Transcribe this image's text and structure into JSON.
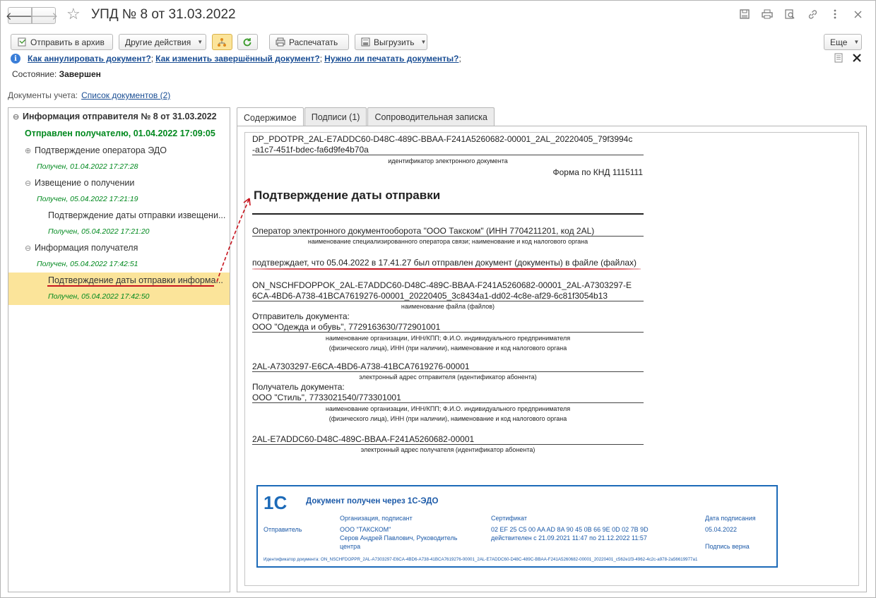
{
  "window": {
    "title": "УПД № 8 от 31.03.2022",
    "nav_back": "🡐",
    "nav_forward": "🡒",
    "star_icon": "☆",
    "icons": [
      "save-icon",
      "print-icon",
      "preview-icon",
      "link-icon",
      "more-icon",
      "close-icon"
    ]
  },
  "toolbar": {
    "archive_label": "Отправить в архив",
    "other_actions_label": "Другие действия",
    "print_label": "Распечатать",
    "export_label": "Выгрузить",
    "more_label": "Еще"
  },
  "help": {
    "link1": "Как аннулировать документ?",
    "link2": "Как изменить завершённый документ?",
    "link3": "Нужно ли печатать документы?",
    "sep": ";"
  },
  "state": {
    "label": "Состояние:",
    "value": "Завершен"
  },
  "docs": {
    "label": "Документы учета:",
    "link": "Список документов (2)"
  },
  "tree": {
    "root": "Информация отправителя № 8 от 31.03.2022",
    "root_status": "Отправлен получателю, 01.04.2022 17:09:05",
    "items": [
      {
        "label": "Подтверждение оператора ЭДО",
        "status": "Получен, 01.04.2022 17:27:28"
      },
      {
        "label": "Извещение о получении",
        "status": "Получен, 05.04.2022 17:21:19"
      },
      {
        "label": "Подтверждение даты отправки извещени...",
        "status": "Получен, 05.04.2022 17:21:20"
      },
      {
        "label": "Информация получателя",
        "status": "Получен, 05.04.2022 17:42:51"
      },
      {
        "label": "Подтверждение даты отправки информа...",
        "status": "Получен, 05.04.2022 17:42:50"
      }
    ]
  },
  "tabs": [
    {
      "label": "Содержимое"
    },
    {
      "label": "Подписи (1)"
    },
    {
      "label": "Сопроводительная записка"
    }
  ],
  "document": {
    "id_line1": "DP_PDOTPR_2AL-E7ADDC60-D48C-489C-BBAA-F241A5260682-00001_2AL_20220405_79f3994c",
    "id_line2": "-a1c7-451f-bdec-fa6d9fe4b70a",
    "id_caption": "идентификатор электронного документа",
    "form": "Форма по КНД 1115111",
    "title": "Подтверждение даты отправки",
    "operator": "Оператор электронного документооборота \"ООО Такском\" (ИНН 7704211201, код 2AL)",
    "operator_caption": "наименование специализированного оператора связи; наименование и код налогового органа",
    "confirms": "подтверждает, что 05.04.2022 в 17.41.27 был отправлен документ (документы) в файле (файлах)",
    "file_line1": "ON_NSCHFDOPPOK_2AL-E7ADDC60-D48C-489C-BBAA-F241A5260682-00001_2AL-A7303297-E",
    "file_line2": "6CA-4BD6-A738-41BCA7619276-00001_20220405_3c8434a1-dd02-4c8e-af29-6c81f3054b13",
    "file_caption": "наименование файла (файлов)",
    "sender_label": "Отправитель документа:",
    "sender": "ООО \"Одежда и обувь\", 7729163630/772901001",
    "org_caption1": "наименование организации, ИНН/КПП; Ф.И.О. индивидуального предпринимателя",
    "org_caption2": "(физического лица), ИНН (при наличии), наименование и код налогового органа",
    "sender_addr": "2AL-A7303297-E6CA-4BD6-A738-41BCA7619276-00001",
    "sender_addr_caption": "электронный адрес отправителя (идентификатор абонента)",
    "recipient_label": "Получатель документа:",
    "recipient": "ООО \"Стиль\", 7733021540/773301001",
    "recipient_addr": "2AL-E7ADDC60-D48C-489C-BBAA-F241A5260682-00001",
    "recipient_addr_caption": "электронный адрес получателя (идентификатор абонента)"
  },
  "stamp": {
    "logo_text": "1С",
    "title": "Документ получен через 1С-ЭДО",
    "col_org": "Организация, подписант",
    "col_cert": "Сертификат",
    "col_date": "Дата подписания",
    "role": "Отправитель",
    "org": "ООО \"ТАКСКОМ\"",
    "signer1": "Серов Андрей Павлович, Руководитель",
    "signer2": "центра",
    "cert": "02 EF 25 C5 00 AA AD 8A 90 45 0B 66 9E 0D 02 7B 9D",
    "cert_valid": "действителен с 21.09.2021 11:47 по 21.12.2022 11:57",
    "date": "05.04.2022",
    "sign_ok": "Подпись верна",
    "doc_id": "Идентификатор документа: ON_NSCHFDOPPR_2AL-A7303297-E6CA-4BD6-A738-41BCA7619276-00001_2AL-E7ADDC60-D48C-489C-BBAA-F241A5260682-00001_20220401_c562e1f3-4962-4c2c-a978-2a56619977a1"
  },
  "colors": {
    "accent": "#fbe49a",
    "link": "#1a4e94",
    "green": "#00891e",
    "annotation": "#c8141e",
    "stamp": "#1c6ab8"
  }
}
